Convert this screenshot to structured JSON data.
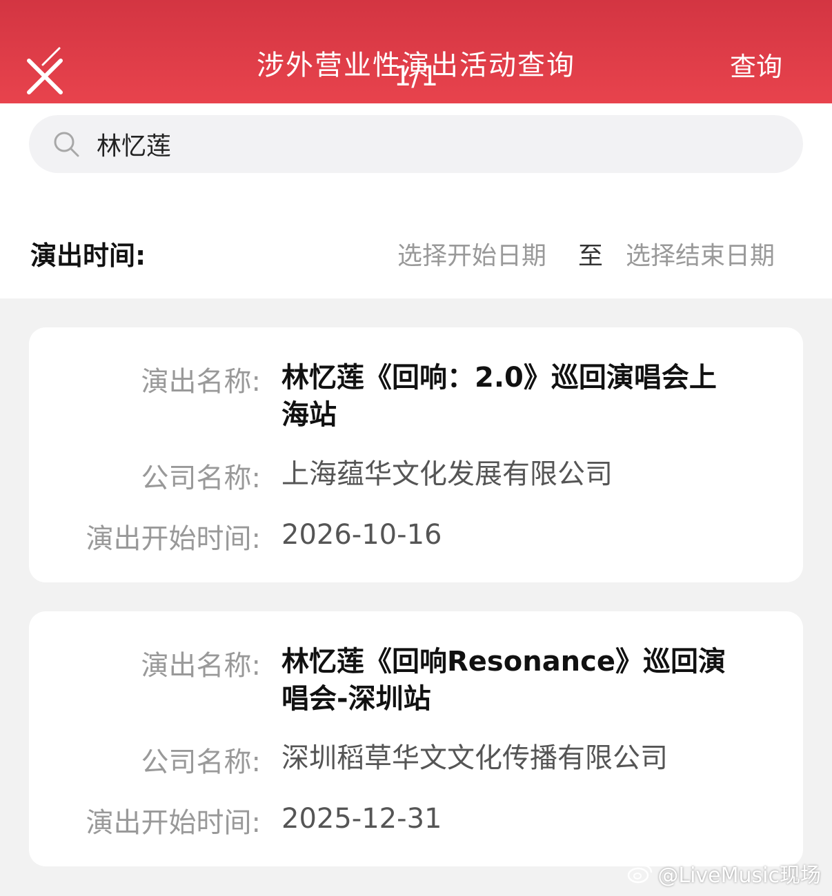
{
  "header": {
    "title": "涉外营业性演出活动查询",
    "page_indicator": "1/1",
    "query_label": "查询",
    "background": "#e23d48",
    "close_icon": "close-icon"
  },
  "search": {
    "icon": "search-icon",
    "value": "林忆莲"
  },
  "time_filter": {
    "label": "演出时间:",
    "start_placeholder": "选择开始日期",
    "separator": "至",
    "end_placeholder": "选择结束日期"
  },
  "results": [
    {
      "name_label": "演出名称:",
      "name": "林忆莲《回响：2.0》巡回演唱会上海站",
      "company_label": "公司名称:",
      "company": "上海蕴华文化发展有限公司",
      "start_label": "演出开始时间:",
      "start": "2026-10-16"
    },
    {
      "name_label": "演出名称:",
      "name": "林忆莲《回响Resonance》巡回演唱会-深圳站",
      "company_label": "公司名称:",
      "company": "深圳稻草华文文化传播有限公司",
      "start_label": "演出开始时间:",
      "start": "2025-12-31"
    }
  ],
  "watermark": {
    "text": "@LiveMusic现场",
    "icon": "weibo-logo-icon"
  }
}
